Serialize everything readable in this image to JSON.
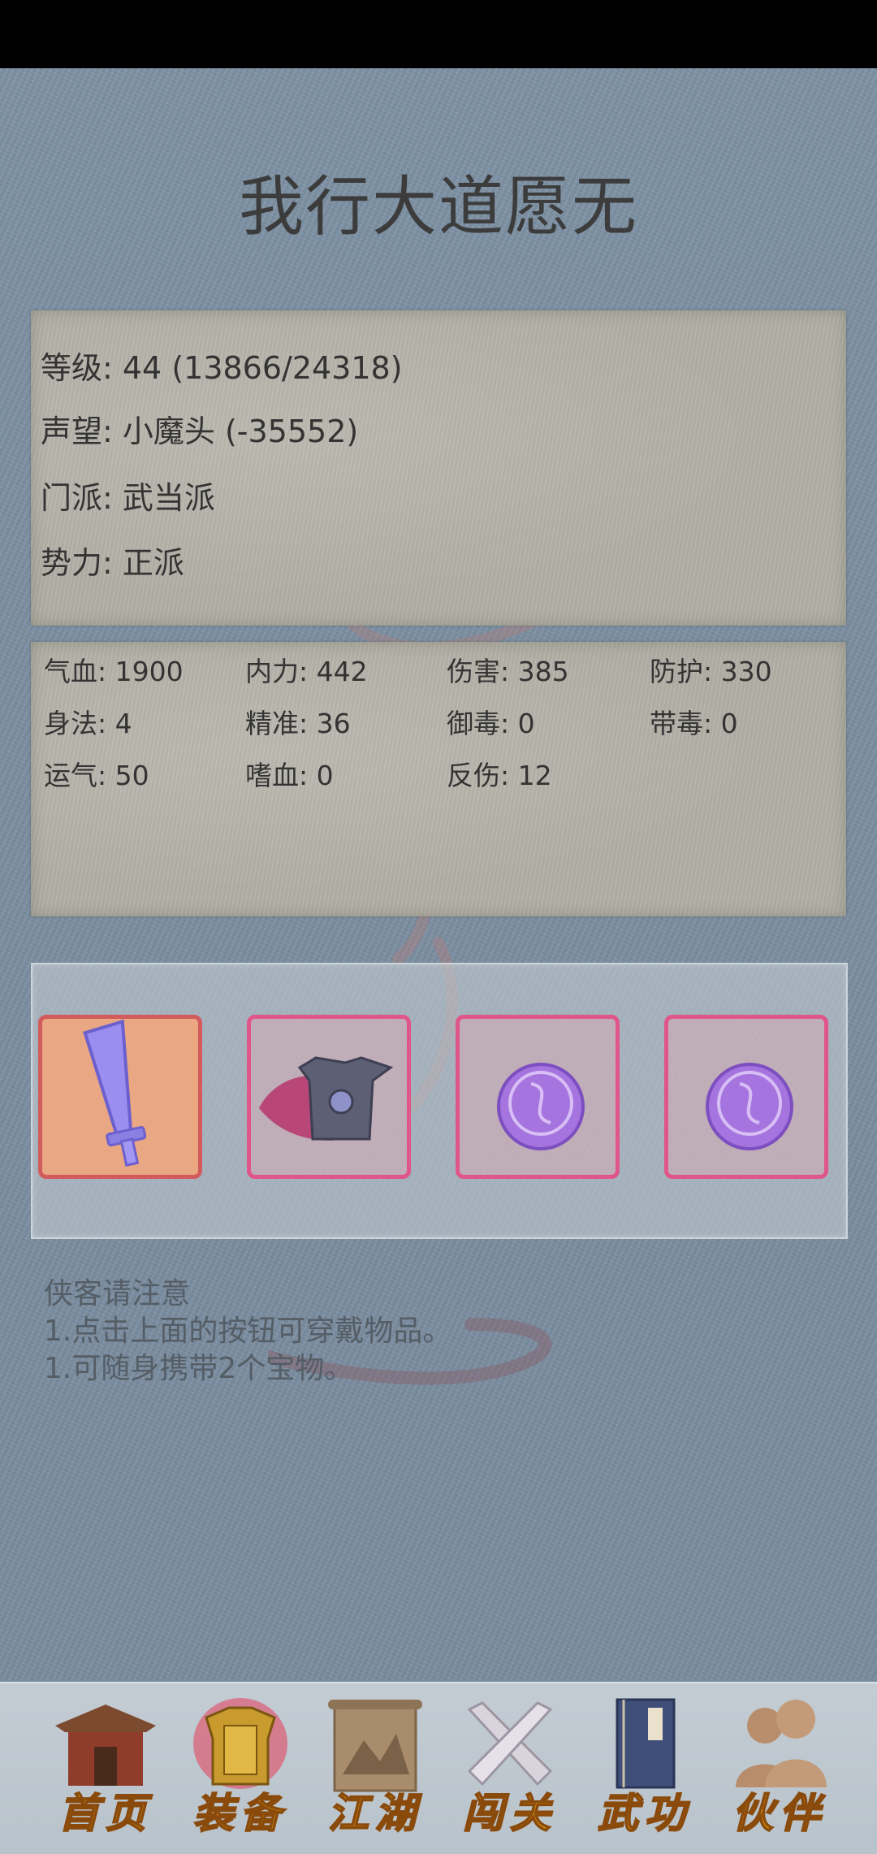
{
  "page": {
    "title": "我行大道愿无"
  },
  "info": {
    "level": "等级: 44 (13866/24318)",
    "reputation": "声望: 小魔头 (-35552)",
    "sect": "门派: 武当派",
    "faction": "势力:  正派"
  },
  "stats": {
    "hp": "气血: 1900",
    "mp": "内力: 442",
    "damage": "伤害: 385",
    "defense": "防护: 330",
    "agility": "身法: 4",
    "accuracy": "精准: 36",
    "poison_resist": "御毒: 0",
    "poison": "带毒: 0",
    "luck": "运气: 50",
    "lifesteal": "嗜血: 0",
    "reflect": "反伤: 12"
  },
  "equipment": {
    "slots": [
      {
        "icon": "sword-icon",
        "state": "selected"
      },
      {
        "icon": "armor-icon",
        "state": "normal"
      },
      {
        "icon": "treasure-seal-icon",
        "state": "normal"
      },
      {
        "icon": "treasure-seal-icon",
        "state": "normal"
      }
    ]
  },
  "notice": {
    "heading": "侠客请注意",
    "line1": "1.点击上面的按钮可穿戴物品。",
    "line2": "1.可随身携带2个宝物。"
  },
  "nav": {
    "home": "首页",
    "equip": "装备",
    "jianghu": "江湖",
    "challenge": "闯关",
    "martial": "武功",
    "partner": "伙伴"
  },
  "colors": {
    "background": "#7f93a5",
    "panel": "#b2b0a6",
    "slot_border": "#e0558a",
    "nav_text": "#f1b51a"
  }
}
